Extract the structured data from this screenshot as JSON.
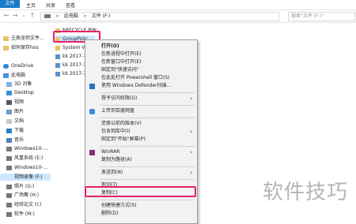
{
  "ribbon": {
    "tabs": [
      "文件",
      "主页",
      "共享",
      "查看"
    ]
  },
  "address": {
    "path_root": "此电脑",
    "path_sep": ">",
    "path_drive": "文件 (F:)",
    "search_placeholder": "搜索\"文件 (F:)\""
  },
  "nav": {
    "items": [
      "壬辰龙师文件...",
      "如何保存hos",
      "OneDrive",
      "此电脑",
      "3D 对象",
      "Desktop",
      "视频",
      "图片",
      "文档",
      "下载",
      "音乐",
      "Windows10-...",
      "风重系统 (E:)",
      "Windows10-...",
      "视频录像 (F:)",
      "照片 (G:)",
      "广场舞 (H:)",
      "经验论文 (I:)",
      "软件 (M:)"
    ]
  },
  "files": [
    "$RECYCLE.BIN",
    "GroupPolic",
    "System Volu",
    "kk 2017-12-...",
    "kk 2017-12-...",
    "kk 2017-12-..."
  ],
  "menu": {
    "open": "打开(O)",
    "open_new_process": "在新进程中打开(E)",
    "open_new_window": "在新窗口中打开(E)",
    "pin_quick": "固定到\"快速访问\"",
    "powershell": "在此处打开 Powershell 窗口(S)",
    "defender": "使用 Windows Defender扫描...",
    "grant_access": "授予访问权限(G)",
    "upload_baidu": "上传到百度网盘",
    "restore": "还原以前的版本(V)",
    "include_library": "包含到库中(I)",
    "pin_start": "固定到\"开始\"屏幕(P)",
    "winrar": "WinRAR",
    "copy_path": "复制为路径(A)",
    "send_to": "发送到(N)",
    "cut": "剪切(T)",
    "copy": "复制(C)",
    "create_shortcut": "创建快捷方式(S)",
    "delete": "删除(D)"
  },
  "watermark": "软件技巧",
  "colors": {
    "accent": "#1979ca",
    "highlight": "#e6206f",
    "selection": "#cce8ff"
  }
}
